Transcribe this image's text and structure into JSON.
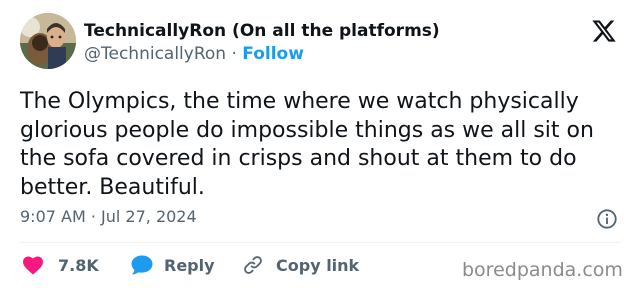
{
  "author": {
    "display_name": "TechnicallyRon (On all the platforms)",
    "handle": "@TechnicallyRon",
    "separator": "·",
    "follow_label": "Follow"
  },
  "tweet": {
    "text": "The Olympics, the time where we watch physically glorious people do impossible things as we all sit on the sofa covered in crisps and shout at them to do better. Beautiful.",
    "timestamp": "9:07 AM · Jul 27, 2024"
  },
  "actions": {
    "like_count": "7.8K",
    "reply_label": "Reply",
    "copy_link_label": "Copy link"
  },
  "watermark": "boredpanda.com",
  "icons": {
    "brand": "x-logo-icon",
    "info": "info-icon",
    "like": "heart-icon",
    "reply": "speech-bubble-icon",
    "copy": "link-icon"
  },
  "colors": {
    "accent": "#1d9bf0",
    "like": "#f91880",
    "text": "#0f1419",
    "secondary": "#536471",
    "divider": "#eff3f4",
    "watermark": "#8b8b8b"
  }
}
